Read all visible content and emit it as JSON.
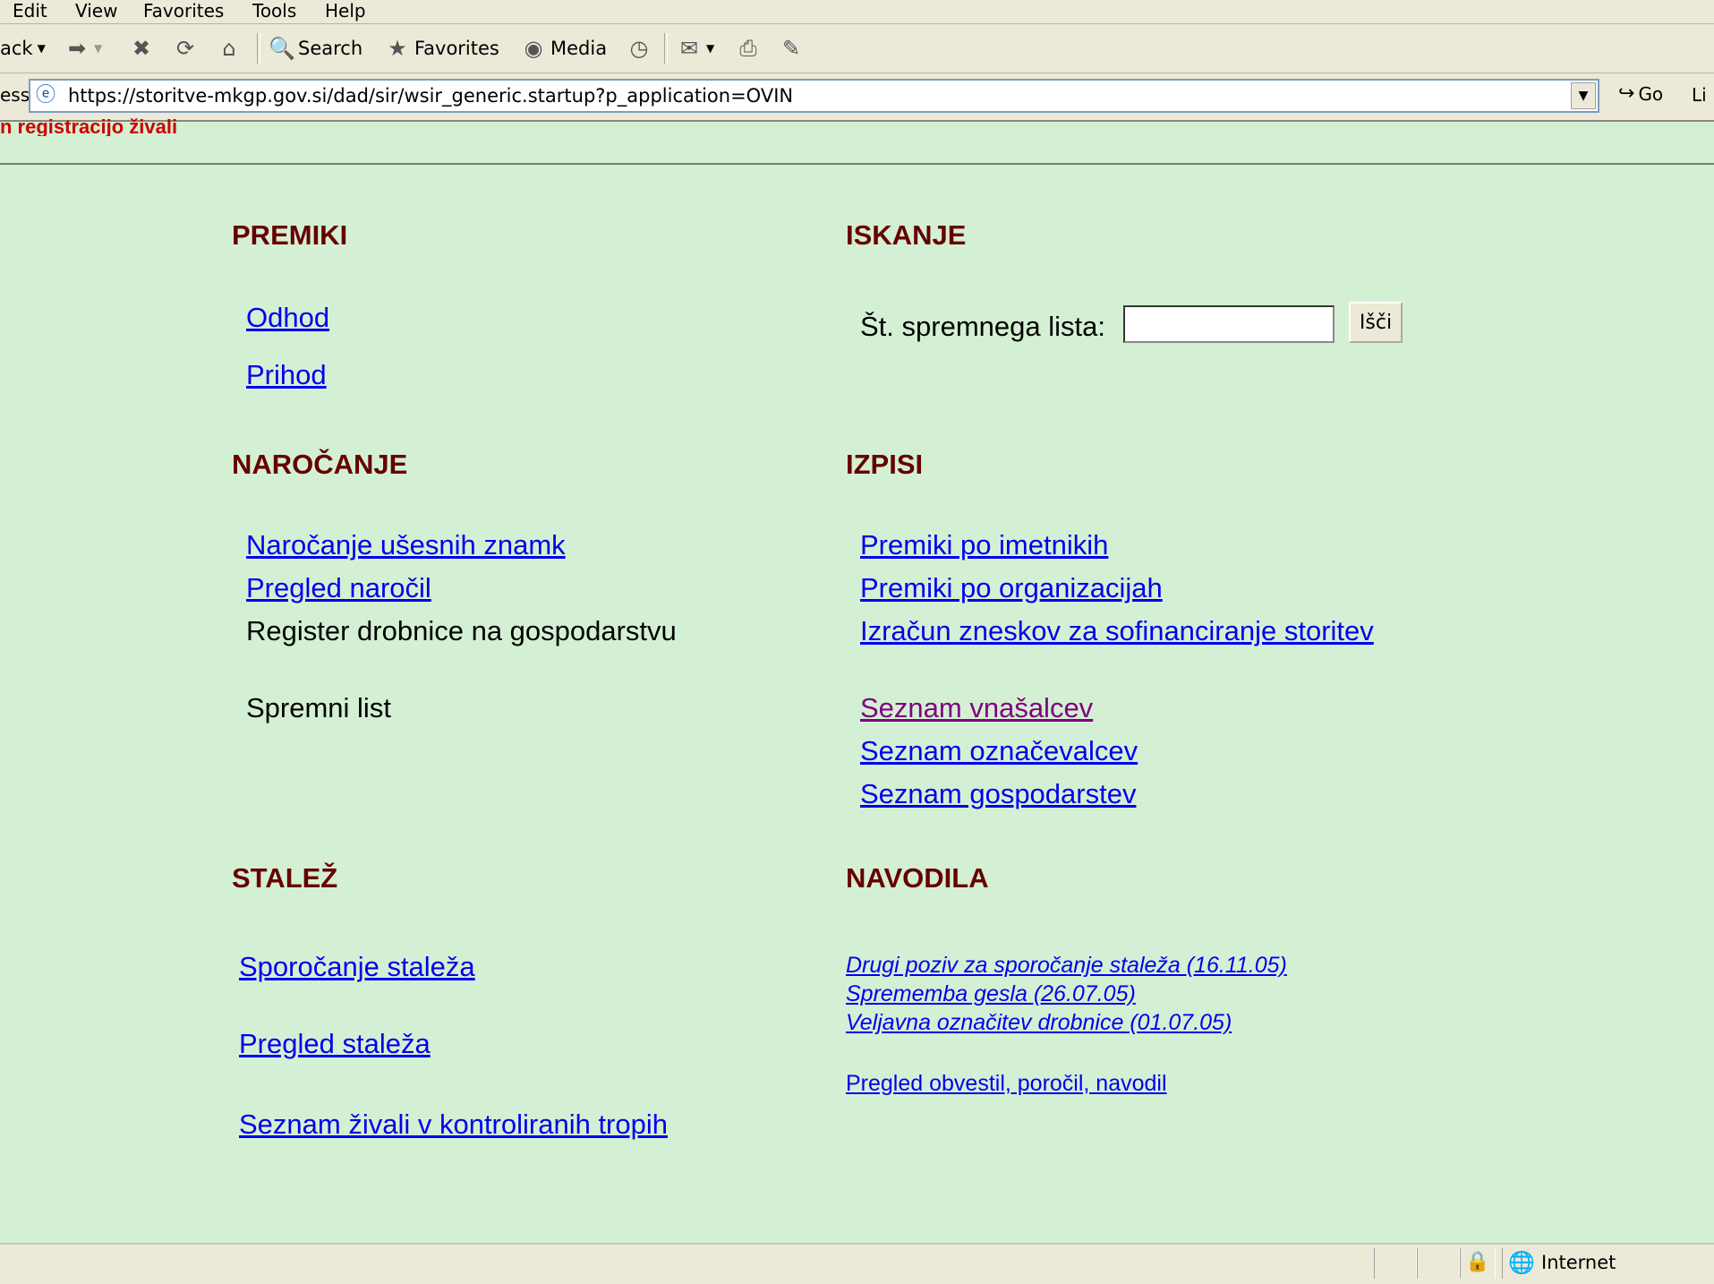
{
  "browser": {
    "menu": [
      "Edit",
      "View",
      "Favorites",
      "Tools",
      "Help"
    ],
    "toolbar": {
      "back_label": "ack",
      "search_label": "Search",
      "favorites_label": "Favorites",
      "media_label": "Media"
    },
    "address": {
      "label": "ess",
      "url": "https://storitve-mkgp.gov.si/dad/sir/wsir_generic.startup?p_application=OVIN",
      "go_label": "Go",
      "links_label": "Li"
    },
    "status": {
      "zone": "Internet"
    }
  },
  "banner": {
    "text": "n registracijo živali"
  },
  "sections": {
    "premiki": {
      "title": "PREMIKI",
      "links": [
        "Odhod",
        "Prihod"
      ]
    },
    "iskanje": {
      "title": "ISKANJE",
      "label": "Št. spremnega lista:",
      "input_value": "",
      "button_label": "Išči"
    },
    "narocanje": {
      "title": "NAROČANJE",
      "links": [
        "Naročanje ušesnih znamk",
        "Pregled naročil"
      ],
      "texts": [
        "Register drobnice na gospodarstvu",
        "Spremni list"
      ]
    },
    "izpisi": {
      "title": "IZPISI",
      "links": [
        "Premiki po imetnikih",
        "Premiki po organizacijah",
        "Izračun zneskov za sofinanciranje storitev",
        "Seznam vnašalcev",
        "Seznam označevalcev",
        "Seznam gospodarstev"
      ]
    },
    "stalez": {
      "title": "STALEŽ",
      "links": [
        "Sporočanje staleža",
        "Pregled staleža",
        "Seznam živali v kontroliranih tropih"
      ]
    },
    "navodila": {
      "title": "NAVODILA",
      "news": [
        "Drugi poziv za sporočanje staleža  (16.11.05)",
        "Sprememba gesla  (26.07.05)",
        "Veljavna označitev drobnice  (01.07.05)"
      ],
      "overview_link": "Pregled obvestil, poročil, navodil"
    }
  }
}
